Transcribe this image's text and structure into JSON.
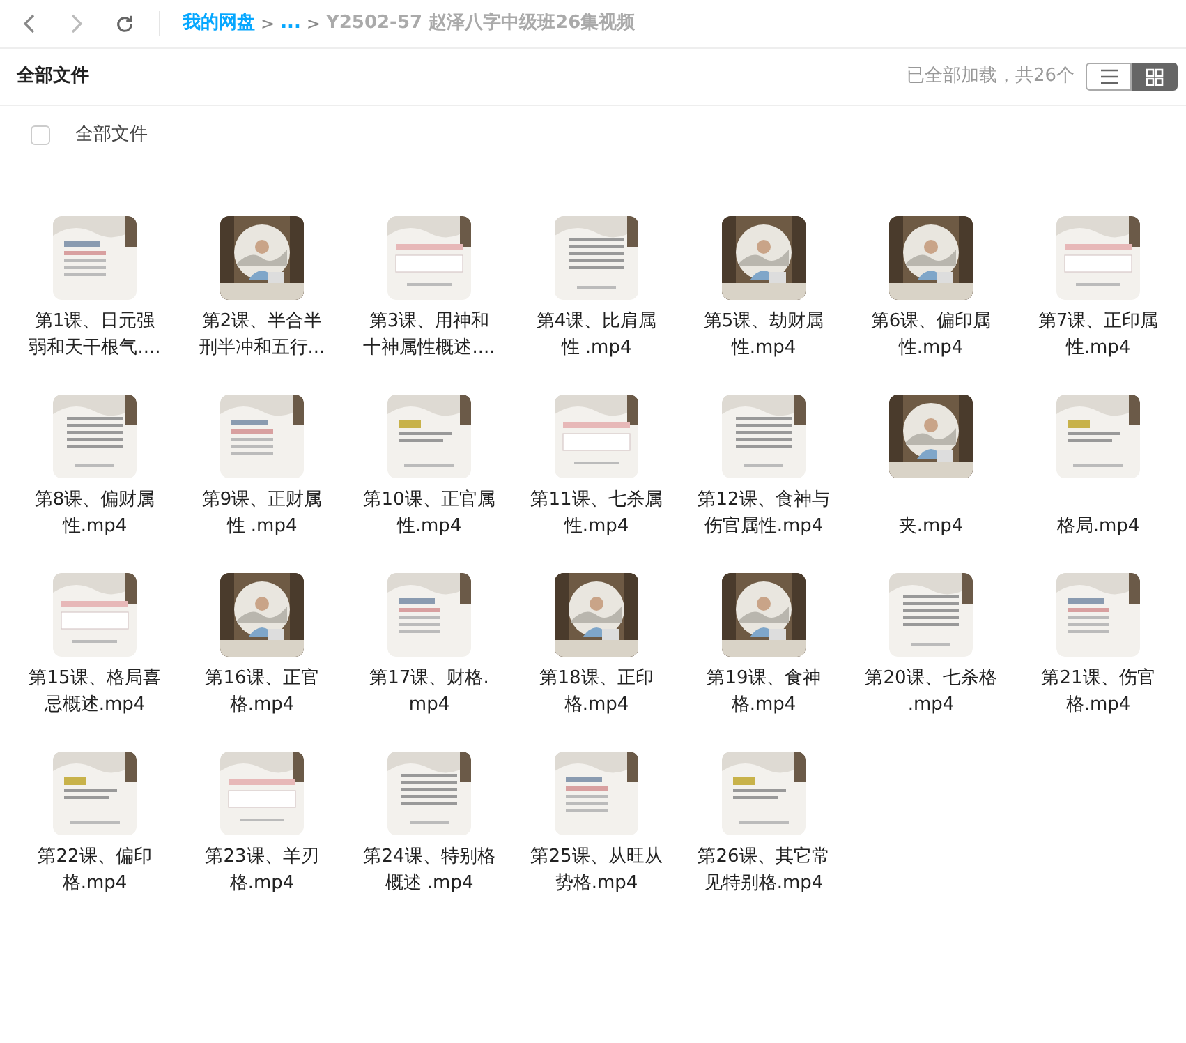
{
  "nav": {
    "breadcrumbs": [
      {
        "kind": "link",
        "text": "我的网盘"
      },
      {
        "kind": "sep",
        "text": ">"
      },
      {
        "kind": "link",
        "text": "..."
      },
      {
        "kind": "sep",
        "text": ">"
      },
      {
        "kind": "current",
        "text": "Y2502-57 赵泽八字中级班26集视频"
      }
    ]
  },
  "header": {
    "title": "全部文件",
    "status": "已全部加载，共26个",
    "view_buttons": [
      {
        "kind": "list",
        "selected": false
      },
      {
        "kind": "grid",
        "selected": true
      }
    ]
  },
  "select_all": {
    "label": "全部文件",
    "checked": false
  },
  "files": [
    {
      "lines": [
        "第1课、日元强",
        "弱和天干根气...."
      ]
    },
    {
      "lines": [
        "第2课、半合半",
        "刑半冲和五行..."
      ]
    },
    {
      "lines": [
        "第3课、用神和",
        "十神属性概述...."
      ]
    },
    {
      "lines": [
        "第4课、比肩属",
        "性 .mp4"
      ]
    },
    {
      "lines": [
        "第5课、劫财属",
        "性.mp4"
      ]
    },
    {
      "lines": [
        "第6课、偏印属",
        "性.mp4"
      ]
    },
    {
      "lines": [
        "第7课、正印属",
        "性.mp4"
      ]
    },
    {
      "lines": [
        "第8课、偏财属",
        "性.mp4"
      ]
    },
    {
      "lines": [
        "第9课、正财属",
        "性 .mp4"
      ]
    },
    {
      "lines": [
        "第10课、正官属",
        "性.mp4"
      ]
    },
    {
      "lines": [
        "第11课、七杀属",
        "性.mp4"
      ]
    },
    {
      "lines": [
        "第12课、食神与",
        "伤官属性.mp4"
      ]
    },
    {
      "lines": [
        "夹.mp4"
      ]
    },
    {
      "lines": [
        "格局.mp4"
      ]
    },
    {
      "lines": [
        "第15课、格局喜",
        "忌概述.mp4"
      ]
    },
    {
      "lines": [
        "第16课、正官",
        "格.mp4"
      ]
    },
    {
      "lines": [
        "第17课、财格.",
        "mp4"
      ]
    },
    {
      "lines": [
        "第18课、正印",
        "格.mp4"
      ]
    },
    {
      "lines": [
        "第19课、食神",
        "格.mp4"
      ]
    },
    {
      "lines": [
        "第20课、七杀格",
        ".mp4"
      ]
    },
    {
      "lines": [
        "第21课、伤官",
        "格.mp4"
      ]
    },
    {
      "lines": [
        "第22课、偏印",
        "格.mp4"
      ]
    },
    {
      "lines": [
        "第23课、羊刃",
        "格.mp4"
      ]
    },
    {
      "lines": [
        "第24课、特别格",
        "概述 .mp4"
      ]
    },
    {
      "lines": [
        "第25课、从旺从",
        "势格.mp4"
      ]
    },
    {
      "lines": [
        "第26课、其它常",
        "见特别格.mp4"
      ]
    }
  ]
}
